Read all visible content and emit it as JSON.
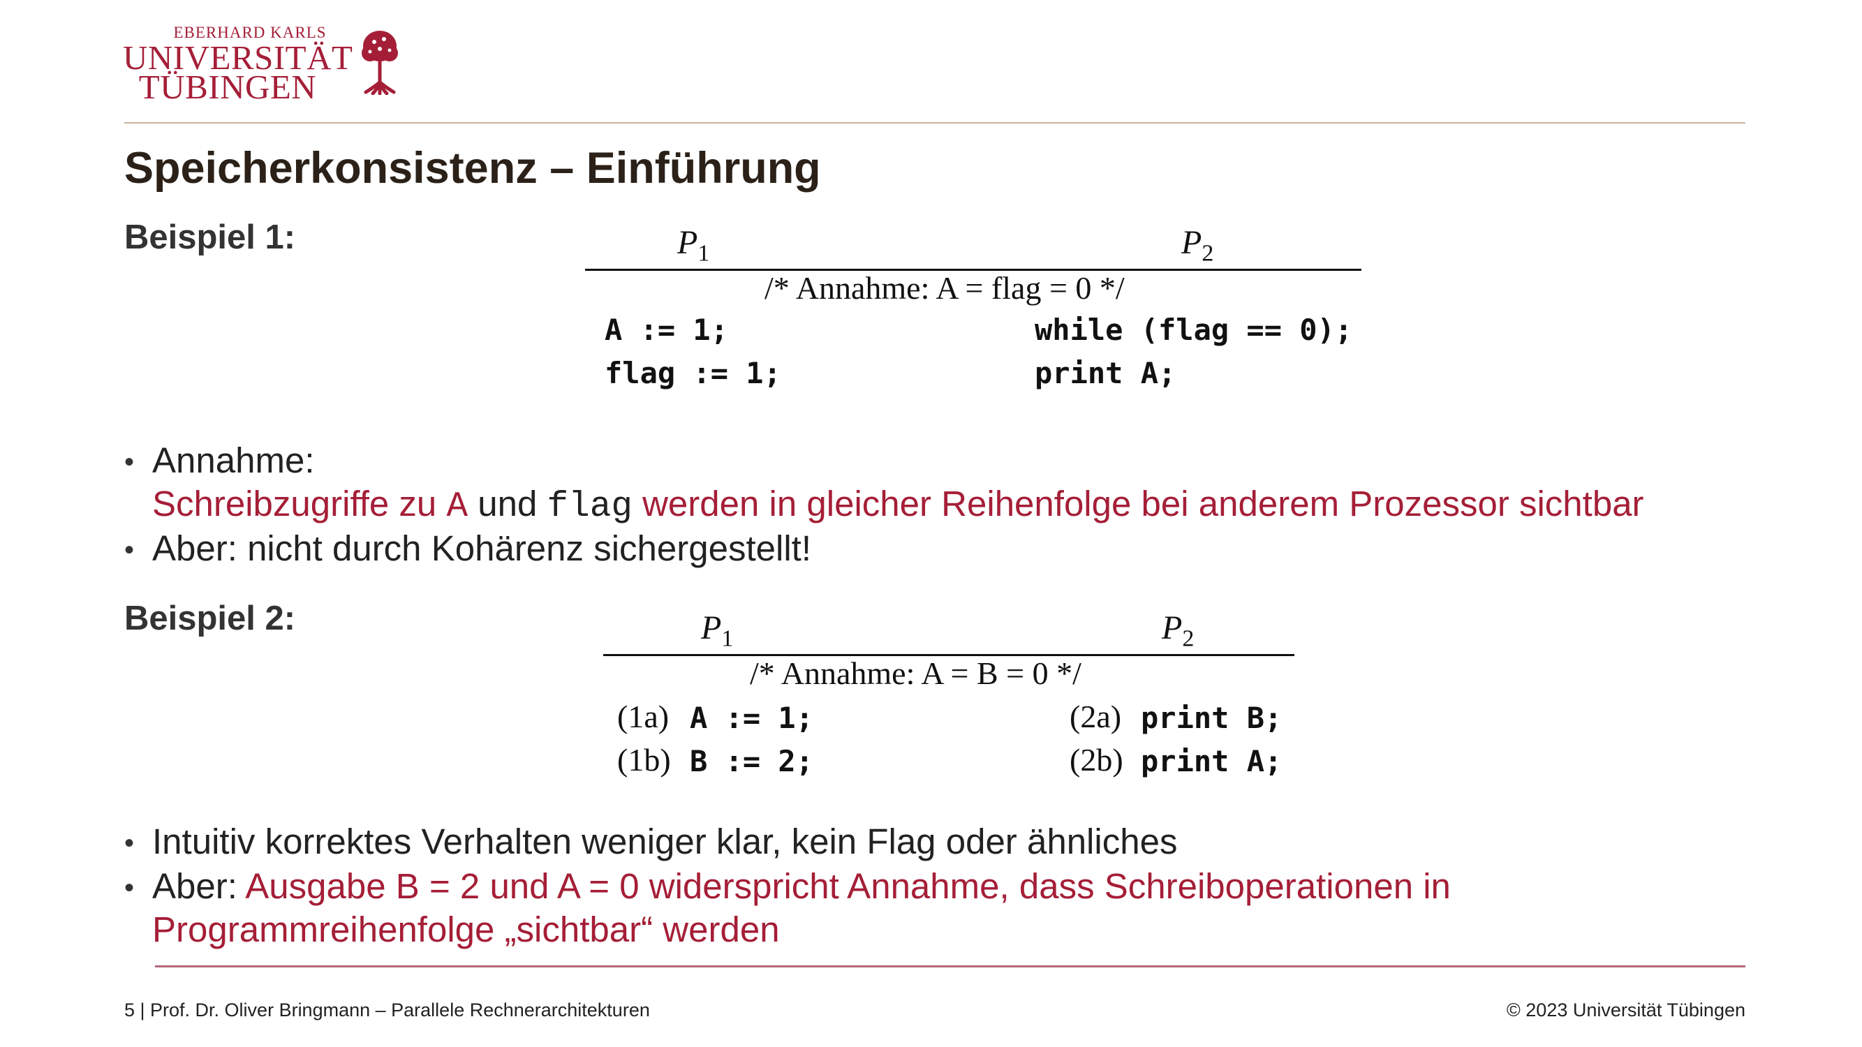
{
  "logo": {
    "line1": "EBERHARD KARLS",
    "line2": "UNIVERSITÄT",
    "line3": "TÜBINGEN",
    "color": "#a51e37"
  },
  "title": "Speicherkonsistenz – Einführung",
  "example1": {
    "label": "Beispiel 1:",
    "p1": "P",
    "p1_sub": "1",
    "p2": "P",
    "p2_sub": "2",
    "assumption": "/* Annahme: A = flag = 0 */",
    "p1_lines": [
      "A := 1;",
      "flag := 1;"
    ],
    "p2_lines": [
      "while (flag == 0);",
      "print A;"
    ]
  },
  "bullets1": {
    "b1_head": "Annahme:",
    "b1_red_1": "Schreibzugriffe zu ",
    "b1_code_1": "A",
    "b1_red_2": " und ",
    "b1_code_2": "flag",
    "b1_red_3": " werden in gleicher Reihenfolge bei anderem Prozessor sichtbar",
    "b2": "Aber: nicht durch Kohärenz sichergestellt!"
  },
  "example2": {
    "label": "Beispiel 2:",
    "p1": "P",
    "p1_sub": "1",
    "p2": "P",
    "p2_sub": "2",
    "assumption": "/* Annahme: A = B = 0 */",
    "p1_tags": [
      "(1a)",
      "(1b)"
    ],
    "p1_lines": [
      "A := 1;",
      "B := 2;"
    ],
    "p2_tags": [
      "(2a)",
      "(2b)"
    ],
    "p2_lines": [
      "print B;",
      "print A;"
    ]
  },
  "bullets2": {
    "b1": "Intuitiv korrektes Verhalten weniger klar, kein Flag oder ähnliches",
    "b2_head": "Aber: ",
    "b2_red_line1": "Ausgabe B = 2 und A = 0 widerspricht Annahme, dass Schreiboperationen in",
    "b2_red_line2": "Programmreihenfolge „sichtbar“ werden"
  },
  "footer": {
    "left": "5 | Prof. Dr. Oliver Bringmann – Parallele Rechnerarchitekturen",
    "right": "© 2023 Universität Tübingen"
  },
  "colors": {
    "accent": "#a51e37",
    "title": "#2b2118",
    "rule_top": "#c9b39c",
    "rule_bottom": "#b5677a"
  }
}
